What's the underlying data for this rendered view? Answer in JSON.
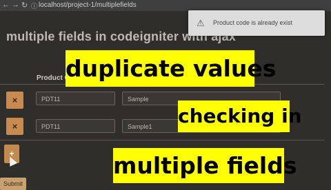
{
  "browser": {
    "url": "localhost/project-1/multiplefields",
    "back_icon": "arrow-left-icon",
    "forward_icon": "arrow-right-icon",
    "reload_icon": "reload-icon",
    "info_icon": "info-icon"
  },
  "page": {
    "title": "multiple fields in codeigniter with ajax"
  },
  "toast": {
    "icon": "warning-icon",
    "message": "Product code is already exist"
  },
  "table": {
    "header_product_code": "Product C",
    "rows": [
      {
        "code": "PDT11",
        "name": "Sample",
        "remove_label": "×"
      },
      {
        "code": "PDT11",
        "name": "Sample1",
        "remove_label": "×"
      }
    ]
  },
  "actions": {
    "add_label": "+",
    "submit_label": "Submit"
  },
  "captions": {
    "line1": "duplicate values",
    "line2": "checking in",
    "line3": "multiple fields"
  },
  "colors": {
    "background": "#2f2e2b",
    "accent": "#c98a4f",
    "caption_bg": "#ffff00"
  }
}
